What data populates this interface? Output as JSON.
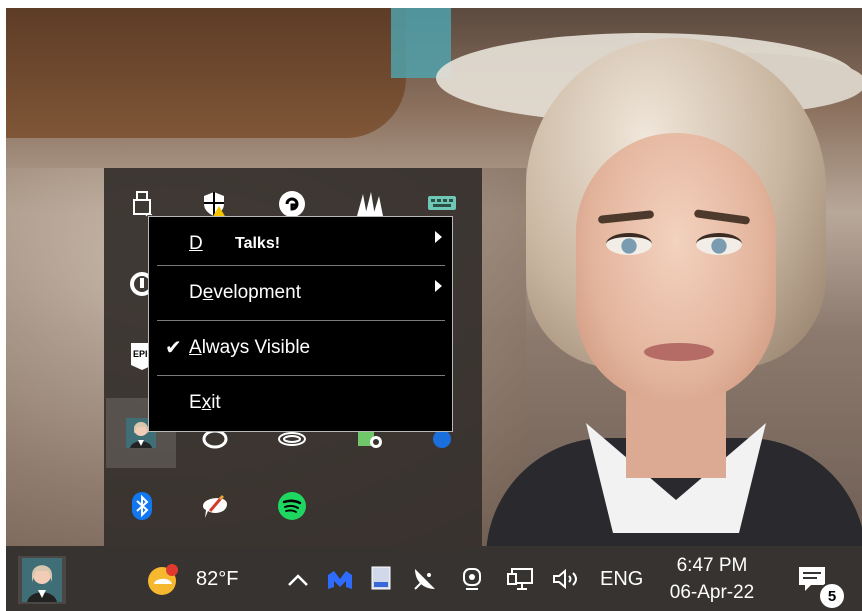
{
  "context_menu": {
    "items": [
      {
        "label_prefix": "D",
        "label_rest": "Talks!",
        "has_submenu": true
      },
      {
        "label": "Development",
        "access_key": "e",
        "has_submenu": true
      },
      {
        "label": "Always Visible",
        "access_key": "A",
        "checked": true
      },
      {
        "label": "Exit",
        "access_key": "x"
      }
    ]
  },
  "taskbar": {
    "temperature": "82°F",
    "language": "ENG",
    "time": "6:47 PM",
    "date": "06-Apr-22",
    "notifications_count": "5"
  },
  "tray_icons": [
    "usb-icon",
    "security-shield-icon",
    "logitech-g-icon",
    "corsair-icon",
    "keyboard-icon",
    "mouse-icon",
    "epic-games-icon",
    "app-portrait-icon",
    "steam-icon",
    "audio-icon",
    "camera-icon",
    "bluetooth-icon",
    "pencil-icon",
    "spotify-icon"
  ],
  "colors": {
    "taskbar": "#363330",
    "menu_bg": "#000000",
    "spotify": "#1ed760",
    "bluetooth": "#1178f2"
  }
}
